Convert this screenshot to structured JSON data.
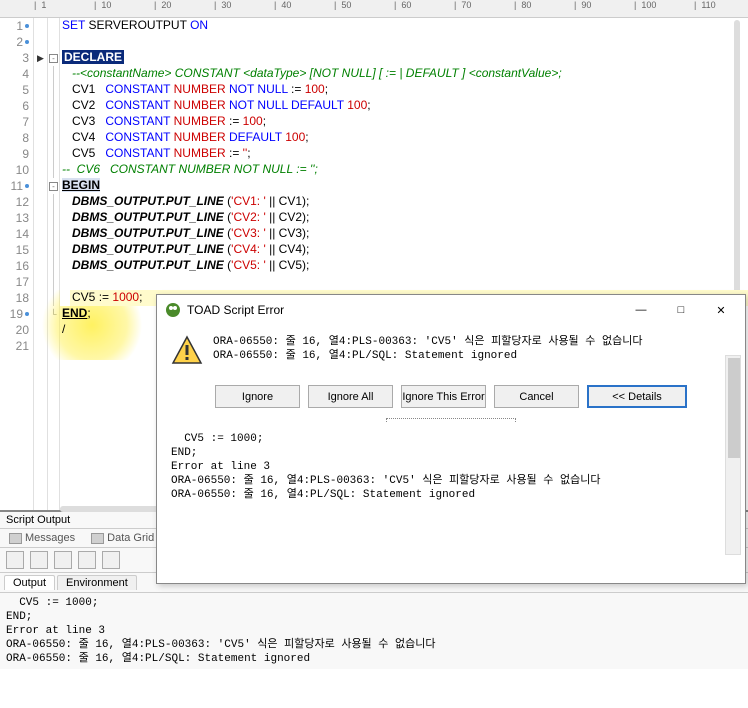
{
  "ruler": {
    "marks": [
      "1",
      "10",
      "20",
      "30",
      "40",
      "50",
      "60",
      "70",
      "80",
      "90",
      "100",
      "110"
    ]
  },
  "gutter": {
    "count": 21
  },
  "code": {
    "l1": {
      "set": "SET",
      "opt": "SERVEROUTPUT",
      "on": "ON"
    },
    "l3": {
      "declare": "DECLARE"
    },
    "l4": {
      "c": "--<constantName> CONSTANT <dataType> [NOT NULL] [ := | DEFAULT ] <constantValue>;"
    },
    "l5": {
      "v": "CV1",
      "kw": "CONSTANT",
      "ty": "NUMBER",
      "nn": "NOT NULL",
      "op": ":=",
      "n": "100",
      "sc": ";"
    },
    "l6": {
      "v": "CV2",
      "kw": "CONSTANT",
      "ty": "NUMBER",
      "nn": "NOT NULL DEFAULT",
      "n": "100",
      "sc": ";"
    },
    "l7": {
      "v": "CV3",
      "kw": "CONSTANT",
      "ty": "NUMBER",
      "op": ":=",
      "n": "100",
      "sc": ";"
    },
    "l8": {
      "v": "CV4",
      "kw": "CONSTANT",
      "ty": "NUMBER",
      "df": "DEFAULT",
      "n": "100",
      "sc": ";"
    },
    "l9": {
      "v": "CV5",
      "kw": "CONSTANT",
      "ty": "NUMBER",
      "op": ":=",
      "q": "''",
      "sc": ";"
    },
    "l10": {
      "c": "--  CV6   CONSTANT NUMBER NOT NULL := '';"
    },
    "l11": {
      "begin": "BEGIN"
    },
    "l12": {
      "fn": "DBMS_OUTPUT.PUT_LINE",
      "lp": " (",
      "s": "'CV1: '",
      "cat": " || ",
      "r": "CV1",
      "rp": ");"
    },
    "l13": {
      "fn": "DBMS_OUTPUT.PUT_LINE",
      "lp": " (",
      "s": "'CV2: '",
      "cat": " || ",
      "r": "CV2",
      "rp": ");"
    },
    "l14": {
      "fn": "DBMS_OUTPUT.PUT_LINE",
      "lp": " (",
      "s": "'CV3: '",
      "cat": " || ",
      "r": "CV3",
      "rp": ");"
    },
    "l15": {
      "fn": "DBMS_OUTPUT.PUT_LINE",
      "lp": " (",
      "s": "'CV4: '",
      "cat": " || ",
      "r": "CV4",
      "rp": ");"
    },
    "l16": {
      "fn": "DBMS_OUTPUT.PUT_LINE",
      "lp": " (",
      "s": "'CV5: '",
      "cat": " || ",
      "r": "CV5",
      "rp": ");"
    },
    "l18": {
      "v": "CV5",
      "op": ":=",
      "n": "1000",
      "sc": ";"
    },
    "l19": {
      "end": "END",
      "sc": ";"
    },
    "l20": {
      "t": "/"
    }
  },
  "dialog": {
    "title": "TOAD Script Error",
    "msg": "ORA-06550: 줄 16, 열4:PLS-00363: 'CV5' 식은 피할당자로 사용될 수 없습니다\nORA-06550: 줄 16, 열4:PL/SQL: Statement ignored",
    "buttons": {
      "ignore": "Ignore",
      "ignoreAll": "Ignore All",
      "ignoreThis": "Ignore This Error",
      "cancel": "Cancel",
      "details": "<< Details"
    },
    "lower": "  CV5 := 1000;\nEND;\nError at line 3\nORA-06550: 줄 16, 열4:PLS-00363: 'CV5' 식은 피할당자로 사용될 수 없습니다\nORA-06550: 줄 16, 열4:PL/SQL: Statement ignored"
  },
  "scriptOutput": {
    "title": "Script Output",
    "tab1": "Messages",
    "tab2": "Data Grid",
    "sub1": "Output",
    "sub2": "Environment",
    "body": "  CV5 := 1000;\nEND;\nError at line 3\nORA-06550: 줄 16, 열4:PLS-00363: 'CV5' 식은 피할당자로 사용될 수 없습니다\nORA-06550: 줄 16, 열4:PL/SQL: Statement ignored"
  }
}
